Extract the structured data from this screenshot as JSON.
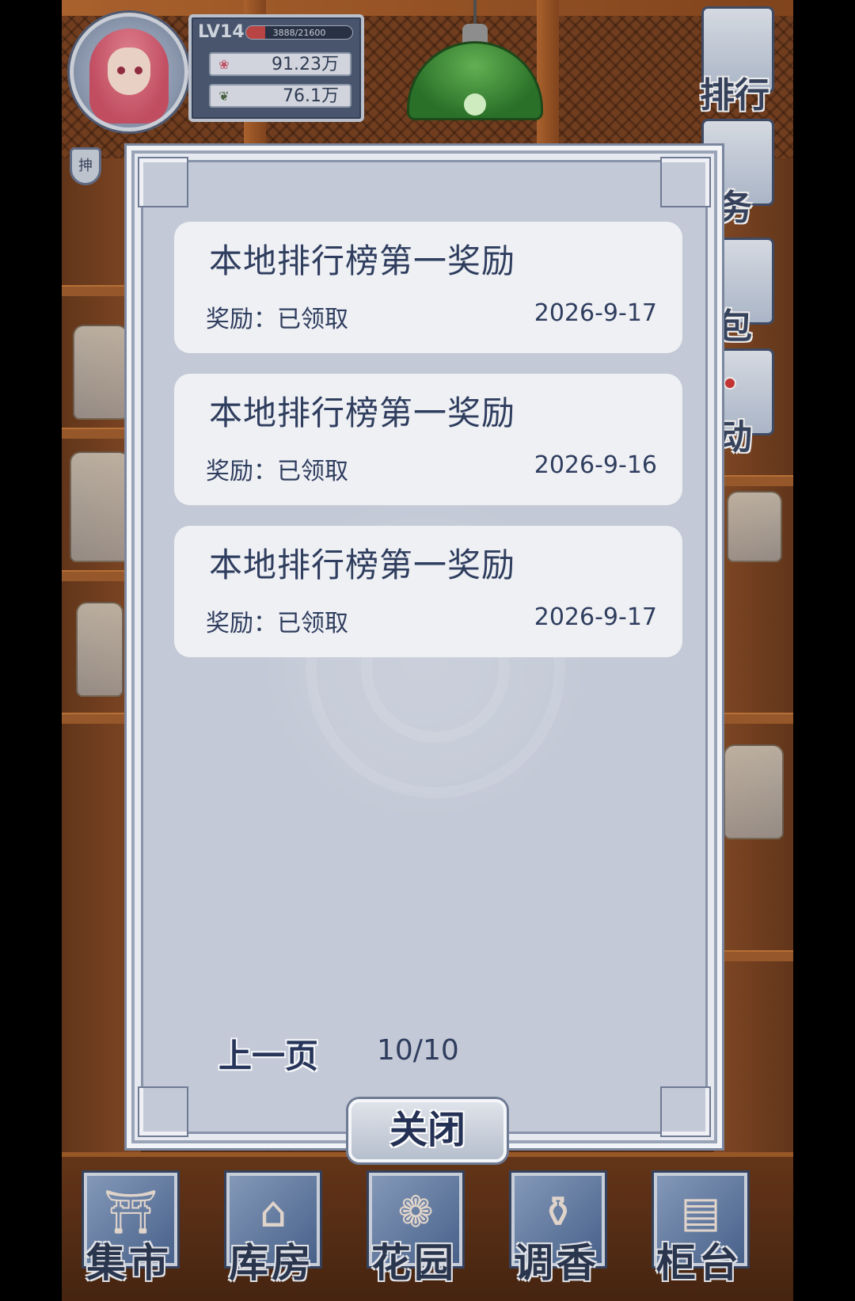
{
  "player": {
    "level": "LV14",
    "xp_text": "3888/21600",
    "xp_progress": 0.18,
    "currency_petals": "91.23万",
    "currency_leaves": "76.1万",
    "badge": "抻"
  },
  "side_menu": {
    "ranking": "排行",
    "tasks": "务",
    "bag": "包",
    "events": "动"
  },
  "modal": {
    "records": [
      {
        "title": "本地排行榜第一奖励",
        "status": "奖励：已领取",
        "date": "2026-9-17"
      },
      {
        "title": "本地排行榜第一奖励",
        "status": "奖励：已领取",
        "date": "2026-9-16"
      },
      {
        "title": "本地排行榜第一奖励",
        "status": "奖励：已领取",
        "date": "2026-9-17"
      }
    ],
    "prev_page_label": "上一页",
    "page_indicator": "10/10",
    "close_label": "关闭"
  },
  "bottom_nav": [
    {
      "label": "集市",
      "icon": "gate-icon"
    },
    {
      "label": "库房",
      "icon": "house-icon"
    },
    {
      "label": "花园",
      "icon": "rose-icon"
    },
    {
      "label": "调香",
      "icon": "perfume-icon"
    },
    {
      "label": "柜台",
      "icon": "counter-icon"
    }
  ],
  "colors": {
    "modal_bg": "#c3c9d6",
    "card_bg": "#eef0f4",
    "text_navy": "#2f3d5e",
    "wood": "#7b4322",
    "lamp_green": "#2e7a2c"
  }
}
